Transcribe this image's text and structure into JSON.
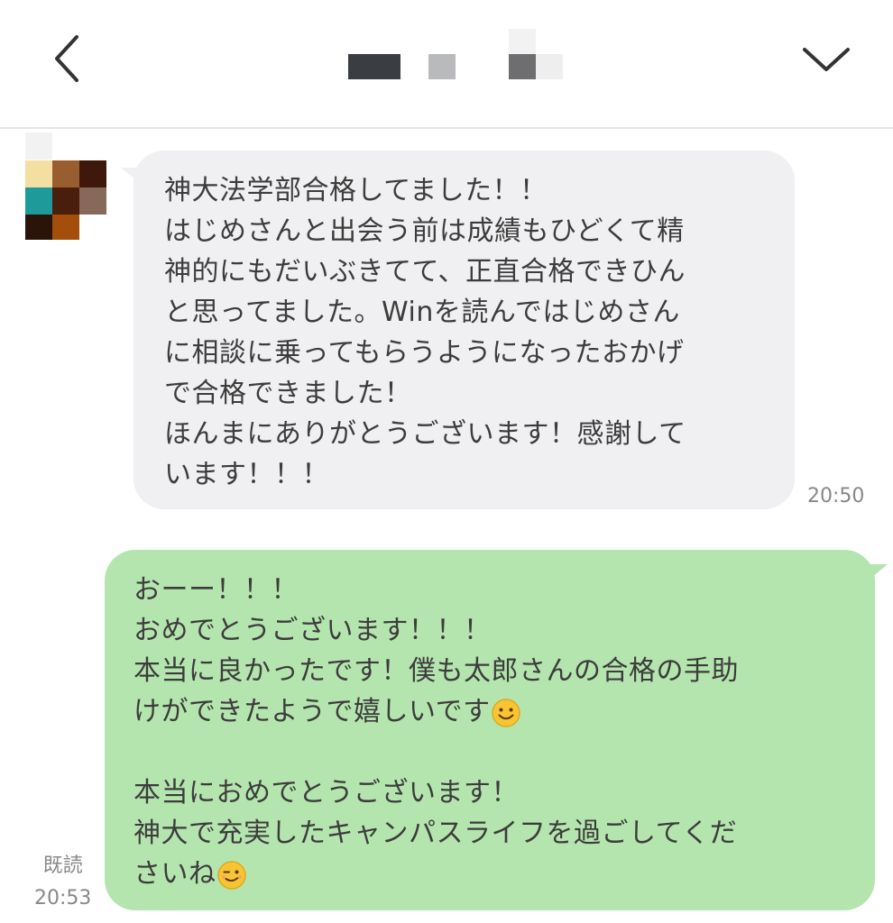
{
  "header": {
    "back_icon": "chevron-left-icon",
    "menu_icon": "chevron-down-icon"
  },
  "messages": {
    "incoming": {
      "lines": [
        "神大法学部合格してました！！",
        "はじめさんと出会う前は成績もひどくて精",
        "神的にもだいぶきてて、正直合格できひん",
        "と思ってました。Winを読んではじめさん",
        "に相談に乗ってもらうようになったおかげ",
        "で合格できました！",
        "ほんまにありがとうございます！感謝して",
        "います！！！"
      ],
      "time": "20:50"
    },
    "outgoing": {
      "lines": [
        "おーー！！！",
        "おめでとうございます！！！",
        "本当に良かったです！僕も太郎さんの合格の手助",
        "けができたようで嬉しいです",
        "",
        "本当におめでとうございます！",
        "神大で充実したキャンパスライフを過ごしてくだ",
        "さいね"
      ],
      "emojis": [
        "smiling-face-emoji",
        "winking-face-emoji"
      ],
      "read_label": "既読",
      "time": "20:53"
    }
  },
  "colors": {
    "incoming_bubble": "#f0f0f2",
    "outgoing_bubble": "#b5e5ae",
    "timestamp": "#888888"
  }
}
